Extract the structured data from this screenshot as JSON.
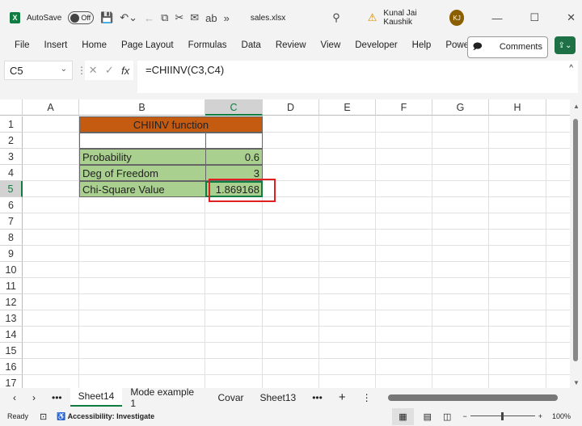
{
  "titlebar": {
    "app_icon": "X",
    "autosave_label": "AutoSave",
    "autosave_state": "Off",
    "filename": "sales.xlsx",
    "user": "Kunal Jai Kaushik",
    "initials": "KJ"
  },
  "menu": {
    "items": [
      "File",
      "Insert",
      "Home",
      "Page Layout",
      "Formulas",
      "Data",
      "Review",
      "View",
      "Developer",
      "Help",
      "Power Pivot"
    ],
    "comments": "Comments"
  },
  "formula_bar": {
    "name_box": "C5",
    "formula": "=CHIINV(C3,C4)"
  },
  "grid": {
    "columns": [
      "A",
      "B",
      "C",
      "D",
      "E",
      "F",
      "G",
      "H"
    ],
    "rows": [
      "1",
      "2",
      "3",
      "4",
      "5",
      "6",
      "7",
      "8",
      "9",
      "10",
      "11",
      "12",
      "13",
      "14",
      "15",
      "16",
      "17"
    ],
    "cells": {
      "title": "CHIINV function",
      "b3": "Probability",
      "c3": "0.6",
      "b4": "Deg of Freedom",
      "c4": "3",
      "b5": "Chi-Square Value",
      "c5": "1.869168"
    },
    "colors": {
      "header_fill": "#c55a11",
      "data_fill": "#a9d08e",
      "highlight_border": "#e02020"
    }
  },
  "sheets": {
    "tabs": [
      "Sheet14",
      "Mode example 1",
      "Covar",
      "Sheet13"
    ],
    "active": "Sheet14"
  },
  "status": {
    "ready": "Ready",
    "accessibility": "Accessibility: Investigate",
    "zoom": "100%"
  }
}
